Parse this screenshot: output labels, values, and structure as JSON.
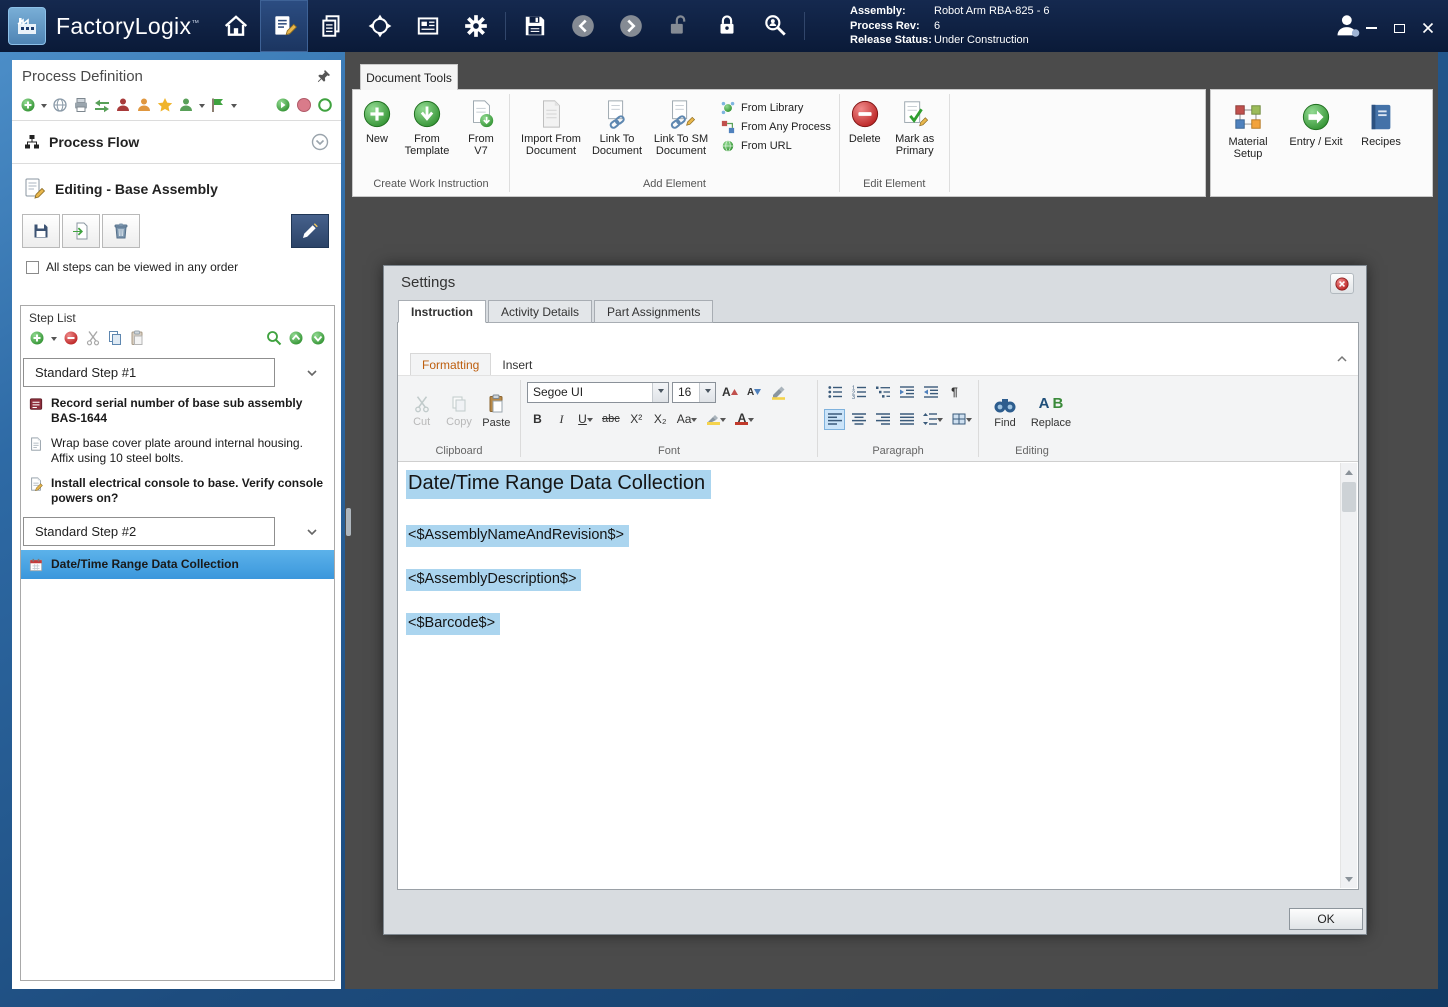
{
  "titlebar": {
    "app_name": "FactoryLogix",
    "trademark": "™",
    "info": {
      "assembly_label": "Assembly:",
      "assembly_value": "Robot Arm RBA-825 - 6",
      "process_rev_label": "Process Rev:",
      "process_rev_value": "6",
      "release_status_label": "Release Status:",
      "release_status_value": "Under Construction"
    }
  },
  "sidebar": {
    "title": "Process Definition",
    "process_flow": "Process Flow",
    "editing_title": "Editing - Base Assembly",
    "order_checkbox_label": "All steps can be viewed in any order",
    "step_list": {
      "title": "Step List",
      "steps": [
        {
          "header": "Standard Step #1",
          "items": [
            {
              "text": "Record serial number of base sub assembly BAS-1644"
            },
            {
              "text": "Wrap base cover plate around internal housing. Affix using 10 steel bolts."
            },
            {
              "text": "Install electrical console to base. Verify console powers on?"
            }
          ]
        },
        {
          "header": "Standard Step #2",
          "items": [
            {
              "text": "Date/Time Range Data Collection"
            }
          ]
        }
      ]
    }
  },
  "ribbon": {
    "tab": "Document Tools",
    "create_group": {
      "label": "Create Work Instruction",
      "new": "New",
      "from_template": "From Template",
      "from_v7": "From V7"
    },
    "add_group": {
      "label": "Add Element",
      "import_from_document": "Import From Document",
      "link_to_document": "Link To Document",
      "link_to_sm_document": "Link To SM Document",
      "from_library": "From Library",
      "from_any_process": "From Any Process",
      "from_url": "From URL"
    },
    "edit_group": {
      "label": "Edit Element",
      "delete": "Delete",
      "mark_as_primary": "Mark as Primary"
    },
    "right_panel": {
      "material_setup": "Material Setup",
      "entry_exit": "Entry / Exit",
      "recipes": "Recipes"
    }
  },
  "dialog": {
    "title": "Settings",
    "tabs": [
      "Instruction",
      "Activity Details",
      "Part Assignments"
    ],
    "ok": "OK",
    "editor": {
      "tabs": [
        "Formatting",
        "Insert"
      ],
      "clipboard": {
        "label": "Clipboard",
        "cut": "Cut",
        "copy": "Copy",
        "paste": "Paste"
      },
      "font": {
        "label": "Font",
        "family": "Segoe UI",
        "size": "16",
        "grow": "A",
        "shrink": "A",
        "bold": "B",
        "italic": "I",
        "underline": "U",
        "strike": "abc",
        "superscript": "X²",
        "subscript": "X₂",
        "case": "Aa",
        "color": "A"
      },
      "paragraph": {
        "label": "Paragraph",
        "pilcrow": "¶"
      },
      "editing": {
        "label": "Editing",
        "find": "Find",
        "replace": "Replace",
        "replace_a": "A",
        "replace_b": "B"
      },
      "document": {
        "title": "Date/Time Range Data Collection",
        "fields": [
          "<$AssemblyNameAndRevision$>",
          "<$AssemblyDescription$>",
          "<$Barcode$>"
        ]
      }
    }
  },
  "colors": {
    "accent_blue": "#3b97dc",
    "highlight_blue": "#abd5ef",
    "titlebar_navy": "#0e2146",
    "formatting_tab_orange": "#bd5e0e"
  }
}
